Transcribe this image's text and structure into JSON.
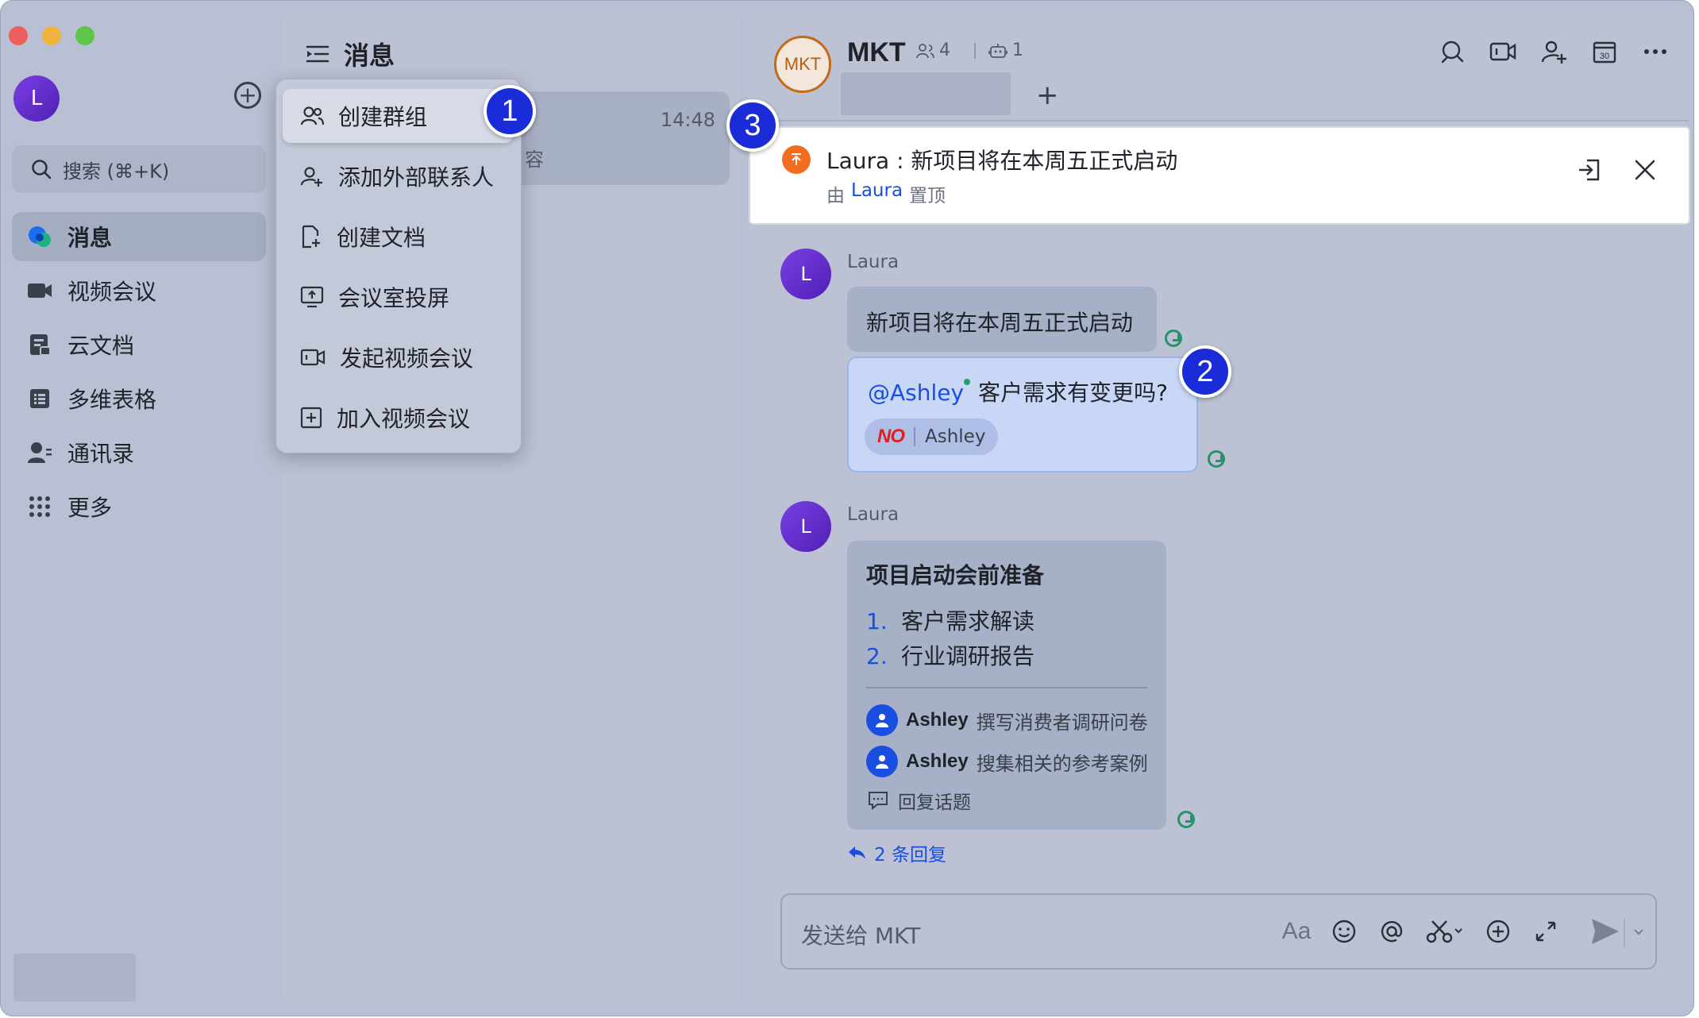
{
  "sidebar": {
    "avatar_initial": "L",
    "search_placeholder": "搜索 (⌘+K)",
    "items": [
      {
        "label": "消息",
        "icon": "messages-icon",
        "active": true
      },
      {
        "label": "视频会议",
        "icon": "video-meeting-icon"
      },
      {
        "label": "云文档",
        "icon": "cloud-docs-icon"
      },
      {
        "label": "多维表格",
        "icon": "base-table-icon"
      },
      {
        "label": "通讯录",
        "icon": "contacts-icon"
      },
      {
        "label": "更多",
        "icon": "more-grid-icon"
      }
    ]
  },
  "list": {
    "title": "消息",
    "chat_item": {
      "time": "14:48",
      "snippet": "容"
    }
  },
  "dropdown": {
    "items": [
      {
        "label": "创建群组",
        "icon": "create-group-icon"
      },
      {
        "label": "添加外部联系人",
        "icon": "add-external-contact-icon"
      },
      {
        "label": "创建文档",
        "icon": "create-doc-icon"
      },
      {
        "label": "会议室投屏",
        "icon": "room-screencast-icon"
      },
      {
        "label": "发起视频会议",
        "icon": "start-video-meeting-icon"
      },
      {
        "label": "加入视频会议",
        "icon": "join-video-meeting-icon"
      }
    ]
  },
  "steps": [
    "1",
    "2",
    "3"
  ],
  "chat": {
    "avatar_text": "MKT",
    "title": "MKT",
    "members_count": "4",
    "bots_count": "1",
    "tab_add": "+"
  },
  "pin": {
    "text": "Laura : 新项目将在本周五正式启动",
    "by_prefix": "由",
    "by_user": "Laura",
    "by_suffix": "置顶"
  },
  "messages": {
    "m1": {
      "avatar": "L",
      "sender": "Laura",
      "text1": "新项目将在本周五正式启动",
      "mention": "@Ashley",
      "text2": "客户需求有变更吗?",
      "reaction_emoji": "NO",
      "reaction_user": "Ashley"
    },
    "m2": {
      "avatar": "L",
      "sender": "Laura",
      "card_title": "项目启动会前准备",
      "list": [
        {
          "num": "1.",
          "text": "客户需求解读"
        },
        {
          "num": "2.",
          "text": "行业调研报告"
        }
      ],
      "tasks": [
        {
          "user": "Ashley",
          "desc": "撰写消费者调研问卷"
        },
        {
          "user": "Ashley",
          "desc": "搜集相关的参考案例"
        }
      ],
      "reply_topic": "回复话题",
      "replies": "2 条回复"
    }
  },
  "composer": {
    "placeholder": "发送给 MKT",
    "font_tool": "Aa"
  },
  "colors": {
    "accent_blue": "#1a4ee0",
    "step_badge": "#1a2bd8",
    "pin_orange": "#f26d1f",
    "avatar_purple": "#6a2fd4",
    "mkt_orange": "#c36b19",
    "read_green": "#25936c"
  }
}
